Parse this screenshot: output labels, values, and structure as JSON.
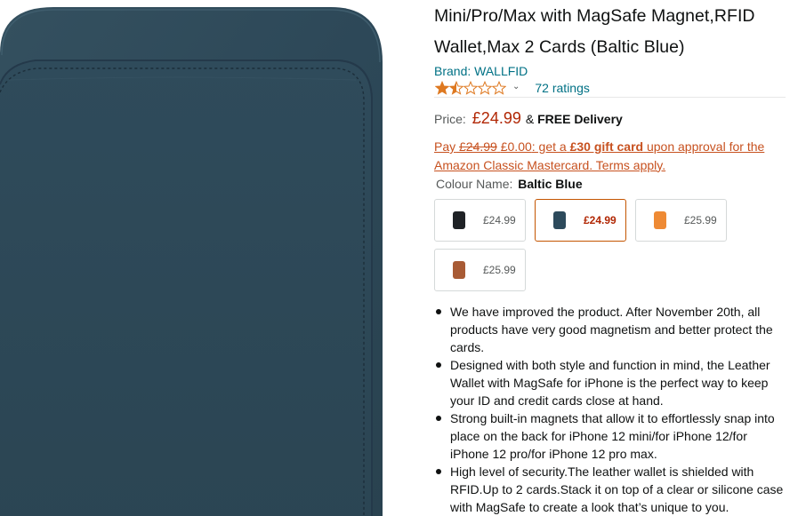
{
  "product": {
    "title_line1": "Mini/Pro/Max with MagSafe Magnet,RFID",
    "title_line2": "Wallet,Max 2 Cards (Baltic Blue)",
    "brand": "Brand: WALLFID",
    "rating": 1.5,
    "rating_max": 5,
    "ratings_count": "72 ratings"
  },
  "price": {
    "label": "Price:",
    "value": "£24.99",
    "delivery_sep": "&",
    "delivery": "FREE Delivery"
  },
  "promo": {
    "pay": "Pay",
    "old_price": "£24.99",
    "new_price": "£0.00",
    "text_a": ": get a",
    "gift": "£30 gift card",
    "text_b": "upon approval for the Amazon Classic Mastercard. Terms apply."
  },
  "colour": {
    "label": "Colour Name:",
    "value": "Baltic Blue"
  },
  "swatches": [
    {
      "price": "£24.99",
      "color": "#1f2226",
      "selected": false
    },
    {
      "price": "£24.99",
      "color": "#2d4a5c",
      "selected": true
    },
    {
      "price": "£25.99",
      "color": "#ee8a34",
      "selected": false
    },
    {
      "price": "£25.99",
      "color": "#a85b35",
      "selected": false
    }
  ],
  "bullets": [
    "We have improved the product. After November 20th, all products have very good magnetism and better protect the cards.",
    "Designed with both style and function in mind, the Leather Wallet with MagSafe for iPhone is the perfect way to keep your ID and credit cards close at hand.",
    "Strong built-in magnets that allow it to effortlessly snap into place on the back for iPhone 12 mini/for iPhone 12/for iPhone 12 pro/for iPhone 12 pro max.",
    "High level of security.The leather wallet is shielded with RFID.Up to 2 cards.Stack it on top of a clear or silicone case with MagSafe to create a look that’s unique to you."
  ],
  "colors": {
    "link": "#007185",
    "price": "#b12704",
    "promo": "#c7511f",
    "star": "#de7921",
    "wallet": "#2e4a5a"
  }
}
